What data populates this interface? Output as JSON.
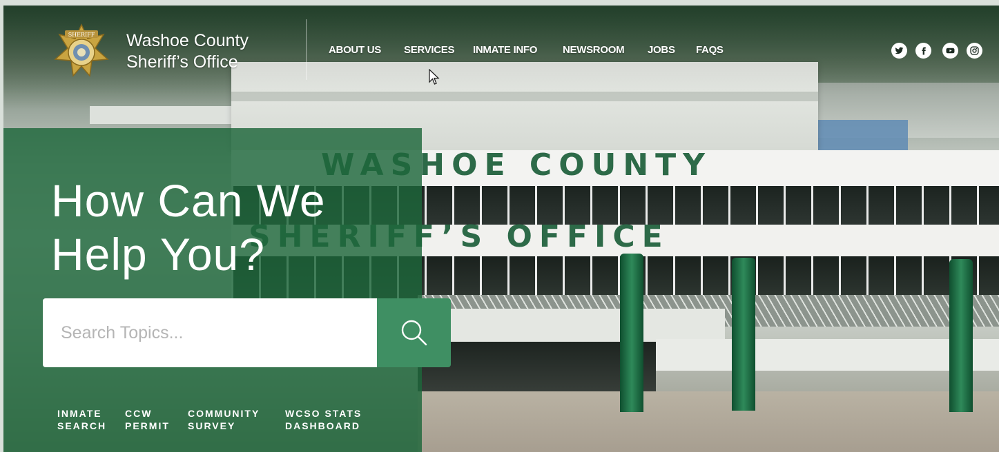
{
  "brand": {
    "line1": "Washoe County",
    "line2": "Sheriff’s Office",
    "badge_icon": "sheriff-star-badge-icon",
    "badge_text": "SHERIFF"
  },
  "nav": {
    "items": [
      {
        "label": "ABOUT US"
      },
      {
        "label": "SERVICES"
      },
      {
        "label": "INMATE INFO"
      },
      {
        "label": "NEWSROOM"
      },
      {
        "label": "JOBS"
      },
      {
        "label": "FAQS"
      }
    ]
  },
  "social": {
    "icons": [
      "twitter-icon",
      "facebook-icon",
      "youtube-icon",
      "instagram-icon"
    ]
  },
  "hero": {
    "sign_line1": "WASHOE   COUNTY",
    "sign_line2": "SHERIFF’S  OFFICE",
    "headline_line1": "How Can We",
    "headline_line2": "Help You?"
  },
  "search": {
    "placeholder": "Search Topics...",
    "icon": "search-icon"
  },
  "quick_links": [
    {
      "label": "INMATE\nSEARCH"
    },
    {
      "label": "CCW\nPERMIT"
    },
    {
      "label": "COMMUNITY\nSURVEY"
    },
    {
      "label": "WCSO STATS\nDASHBOARD"
    }
  ],
  "colors": {
    "panel_green": "#1d663a",
    "accent_green": "#3f8f63",
    "white": "#ffffff"
  }
}
